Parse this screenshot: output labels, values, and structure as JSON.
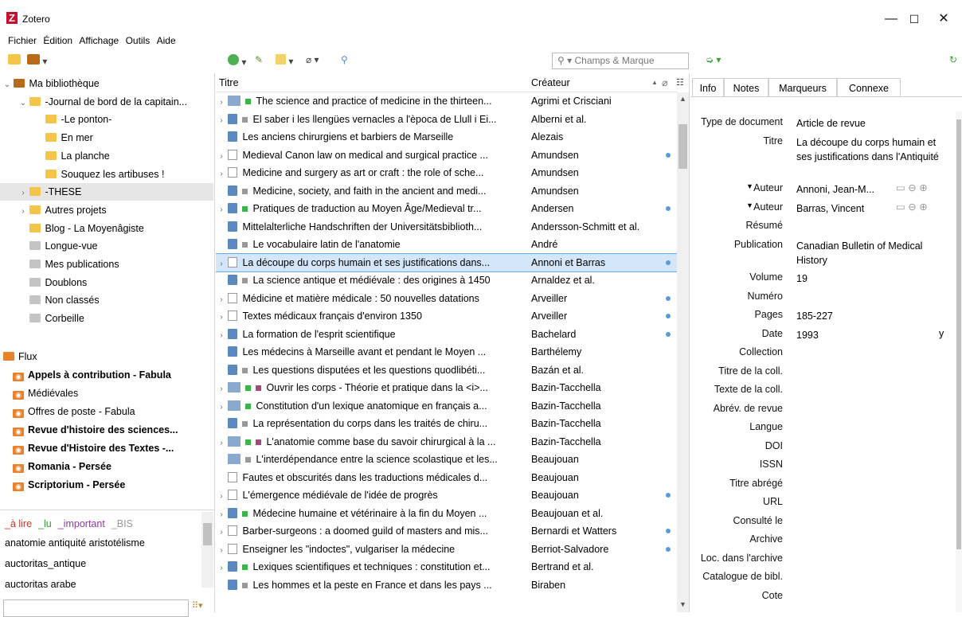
{
  "window": {
    "title": "Zotero",
    "min": "—",
    "max": "☐",
    "close": "✕"
  },
  "menu": [
    "Fichier",
    "Édition",
    "Affichage",
    "Outils",
    "Aide"
  ],
  "search": {
    "placeholder": "Champs & Marque"
  },
  "collections": [
    {
      "label": "Ma bibliothèque",
      "icon": "library-icon",
      "indent": 0,
      "twisty": "⌄"
    },
    {
      "label": "-Journal de bord de la capitain...",
      "icon": "folder-icon",
      "indent": 1,
      "twisty": "⌄"
    },
    {
      "label": "-Le ponton-",
      "icon": "folder-icon",
      "indent": 2,
      "twisty": ""
    },
    {
      "label": "En mer",
      "icon": "folder-icon",
      "indent": 2,
      "twisty": ""
    },
    {
      "label": "La planche",
      "icon": "folder-icon",
      "indent": 2,
      "twisty": ""
    },
    {
      "label": "Souquez les artibuses !",
      "icon": "folder-icon",
      "indent": 2,
      "twisty": ""
    },
    {
      "label": "-THESE",
      "icon": "folder-icon",
      "indent": 1,
      "twisty": "›"
    },
    {
      "label": "Autres projets",
      "icon": "folder-icon",
      "indent": 1,
      "twisty": "›"
    },
    {
      "label": "Blog - La Moyenâgiste",
      "icon": "folder-icon",
      "indent": 1,
      "twisty": ""
    },
    {
      "label": "Longue-vue",
      "icon": "saved-search-icon",
      "indent": 1,
      "twisty": ""
    },
    {
      "label": "Mes publications",
      "icon": "publications-icon",
      "indent": 1,
      "twisty": ""
    },
    {
      "label": "Doublons",
      "icon": "duplicates-icon",
      "indent": 1,
      "twisty": ""
    },
    {
      "label": "Non classés",
      "icon": "unfiled-icon",
      "indent": 1,
      "twisty": ""
    },
    {
      "label": "Corbeille",
      "icon": "trash-icon",
      "indent": 1,
      "twisty": ""
    }
  ],
  "feeds": {
    "label": "Flux",
    "items": [
      {
        "label": "Appels à contribution - Fabula",
        "bold": true
      },
      {
        "label": "Médiévales",
        "bold": false
      },
      {
        "label": "Offres de poste - Fabula",
        "bold": false
      },
      {
        "label": "Revue d'histoire des sciences...",
        "bold": true
      },
      {
        "label": "Revue d'Histoire des Textes -...",
        "bold": true
      },
      {
        "label": "Romania - Persée",
        "bold": true
      },
      {
        "label": "Scriptorium - Persée",
        "bold": true
      }
    ]
  },
  "tags": {
    "colored": [
      {
        "label": "_à lire",
        "color": "#c0392b"
      },
      {
        "label": "_lu",
        "color": "#2e9d2e"
      },
      {
        "label": "_important",
        "color": "#8e3a9e"
      },
      {
        "label": "_BIS",
        "color": "#999999"
      }
    ],
    "rows": [
      "anatomie  antiquité  aristotélisme",
      "auctoritas_antique",
      "auctoritas arabe"
    ]
  },
  "columns": {
    "title": "Titre",
    "creator": "Créateur"
  },
  "items": [
    {
      "title": "The science and practice of medicine in the thirteen...",
      "creator": "Agrimi et Crisciani",
      "type": "book",
      "dots": [
        "g"
      ],
      "tw": "›",
      "att": false
    },
    {
      "title": "El saber i les llengües vernacles a l'època de Llull i Ei...",
      "creator": "Alberni et al.",
      "type": "art",
      "dots": [
        "gr"
      ],
      "tw": "›",
      "att": false
    },
    {
      "title": "Les anciens chirurgiens et barbiers de Marseille",
      "creator": "Alezais",
      "type": "art",
      "dots": [],
      "tw": "",
      "att": false
    },
    {
      "title": "Medieval Canon law on medical and surgical practice ...",
      "creator": "Amundsen",
      "type": "doc",
      "dots": [],
      "tw": "›",
      "att": true
    },
    {
      "title": "Medicine and surgery as art or craft : the role of sche...",
      "creator": "Amundsen",
      "type": "doc",
      "dots": [],
      "tw": "›",
      "att": false
    },
    {
      "title": "Medicine, society, and faith in the ancient and medi...",
      "creator": "Amundsen",
      "type": "art",
      "dots": [
        "gr"
      ],
      "tw": "",
      "att": false
    },
    {
      "title": "Pratiques de traduction au Moyen Âge/Medieval tr...",
      "creator": "Andersen",
      "type": "art",
      "dots": [
        "g"
      ],
      "tw": "›",
      "att": true
    },
    {
      "title": "Mittelalterliche Handschriften der Universitätsbiblioth...",
      "creator": "Andersson-Schmitt et al.",
      "type": "art",
      "dots": [],
      "tw": "",
      "att": false
    },
    {
      "title": "Le vocabulaire latin de l'anatomie",
      "creator": "André",
      "type": "art",
      "dots": [
        "gr"
      ],
      "tw": "",
      "att": false
    },
    {
      "title": "La découpe du corps humain et ses justifications dans...",
      "creator": "Annoni et Barras",
      "type": "doc",
      "dots": [],
      "tw": "›",
      "att": true,
      "sel": true
    },
    {
      "title": "La science antique et médiévale : des origines à 1450",
      "creator": "Arnaldez et al.",
      "type": "art",
      "dots": [
        "gr"
      ],
      "tw": "",
      "att": false
    },
    {
      "title": "Médicine et matière médicale : 50 nouvelles datations",
      "creator": "Arveiller",
      "type": "doc",
      "dots": [],
      "tw": "›",
      "att": true
    },
    {
      "title": "Textes médicaux français d'environ 1350",
      "creator": "Arveiller",
      "type": "doc",
      "dots": [],
      "tw": "›",
      "att": true
    },
    {
      "title": "La formation de l'esprit scientifique",
      "creator": "Bachelard",
      "type": "art",
      "dots": [],
      "tw": "›",
      "att": true
    },
    {
      "title": "Les médecins à Marseille avant et pendant le Moyen ...",
      "creator": "Barthélemy",
      "type": "art",
      "dots": [],
      "tw": "",
      "att": false
    },
    {
      "title": "Les questions disputées et les questions quodlibéti...",
      "creator": "Bazán et al.",
      "type": "art",
      "dots": [
        "gr"
      ],
      "tw": "",
      "att": false
    },
    {
      "title": "Ouvrir les corps - Théorie et pratique dans la <i>...",
      "creator": "Bazin-Tacchella",
      "type": "book",
      "dots": [
        "g",
        "p"
      ],
      "tw": "›",
      "att": false
    },
    {
      "title": "Constitution d'un lexique anatomique en français a...",
      "creator": "Bazin-Tacchella",
      "type": "book",
      "dots": [
        "g"
      ],
      "tw": "›",
      "att": false
    },
    {
      "title": "La représentation du corps dans les traités de chiru...",
      "creator": "Bazin-Tacchella",
      "type": "art",
      "dots": [
        "gr"
      ],
      "tw": "",
      "att": false
    },
    {
      "title": "L'anatomie comme base du savoir chirurgical à la ...",
      "creator": "Bazin-Tacchella",
      "type": "book",
      "dots": [
        "g",
        "p"
      ],
      "tw": "›",
      "att": false
    },
    {
      "title": "L'interdépendance entre la science scolastique et les...",
      "creator": "Beaujouan",
      "type": "book",
      "dots": [
        "gr"
      ],
      "tw": "",
      "att": false
    },
    {
      "title": "Fautes et obscurités dans les traductions médicales d...",
      "creator": "Beaujouan",
      "type": "doc",
      "dots": [],
      "tw": "",
      "att": false
    },
    {
      "title": "L'émergence médiévale de l'idée de progrès",
      "creator": "Beaujouan",
      "type": "doc",
      "dots": [],
      "tw": "›",
      "att": true
    },
    {
      "title": "Médecine humaine et vétérinaire à la fin du Moyen ...",
      "creator": "Beaujouan et al.",
      "type": "art",
      "dots": [
        "g"
      ],
      "tw": "›",
      "att": false
    },
    {
      "title": "Barber-surgeons : a doomed guild of masters and mis...",
      "creator": "Bernardi et Watters",
      "type": "doc",
      "dots": [],
      "tw": "›",
      "att": true
    },
    {
      "title": "Enseigner les \"indoctes\", vulgariser la médecine",
      "creator": "Berriot-Salvadore",
      "type": "doc",
      "dots": [],
      "tw": "›",
      "att": true
    },
    {
      "title": "Lexiques scientifiques et techniques : constitution et...",
      "creator": "Bertrand et al.",
      "type": "art",
      "dots": [
        "g"
      ],
      "tw": "›",
      "att": false
    },
    {
      "title": "Les hommes et la peste en France et dans les pays ...",
      "creator": "Biraben",
      "type": "art",
      "dots": [
        "gr"
      ],
      "tw": "",
      "att": false
    }
  ],
  "tabs": [
    "Info",
    "Notes",
    "Marqueurs",
    "Connexe"
  ],
  "fields": [
    {
      "label": "Type de document",
      "value": "Article de revue"
    },
    {
      "label": "Titre",
      "value": "La découpe du corps humain et ses justifications dans l'Antiquité",
      "lines": 3
    },
    {
      "label": "Auteur",
      "value": "Annoni, Jean-M...",
      "author": true
    },
    {
      "label": "Auteur",
      "value": "Barras, Vincent",
      "author": true
    },
    {
      "label": "Résumé",
      "value": ""
    },
    {
      "label": "Publication",
      "value": "Canadian Bulletin of Medical History",
      "lines": 2
    },
    {
      "label": "Volume",
      "value": "19"
    },
    {
      "label": "Numéro",
      "value": ""
    },
    {
      "label": "Pages",
      "value": "185-227"
    },
    {
      "label": "Date",
      "value": "1993",
      "suffix": "y"
    },
    {
      "label": "Collection",
      "value": ""
    },
    {
      "label": "Titre de la coll.",
      "value": ""
    },
    {
      "label": "Texte de la coll.",
      "value": ""
    },
    {
      "label": "Abrév. de revue",
      "value": ""
    },
    {
      "label": "Langue",
      "value": ""
    },
    {
      "label": "DOI",
      "value": ""
    },
    {
      "label": "ISSN",
      "value": ""
    },
    {
      "label": "Titre abrégé",
      "value": ""
    },
    {
      "label": "URL",
      "value": ""
    },
    {
      "label": "Consulté le",
      "value": ""
    },
    {
      "label": "Archive",
      "value": ""
    },
    {
      "label": "Loc. dans l'archive",
      "value": ""
    },
    {
      "label": "Catalogue de bibl.",
      "value": ""
    },
    {
      "label": "Cote",
      "value": ""
    }
  ]
}
